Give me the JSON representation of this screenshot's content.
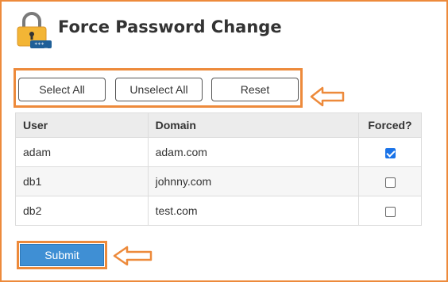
{
  "header": {
    "title": "Force Password Change",
    "icon": "lock-icon",
    "icon_badge_text": "***_"
  },
  "toolbar": {
    "select_all_label": "Select All",
    "unselect_all_label": "Unselect All",
    "reset_label": "Reset"
  },
  "table": {
    "columns": [
      "User",
      "Domain",
      "Forced?"
    ],
    "rows": [
      {
        "user": "adam",
        "domain": "adam.com",
        "forced": true
      },
      {
        "user": "db1",
        "domain": "johnny.com",
        "forced": false
      },
      {
        "user": "db2",
        "domain": "test.com",
        "forced": false
      }
    ]
  },
  "submit_label": "Submit",
  "colors": {
    "highlight": "#ed8a3b",
    "submit_bg": "#3f8fd4",
    "checkbox_checked": "#1a73e8"
  }
}
